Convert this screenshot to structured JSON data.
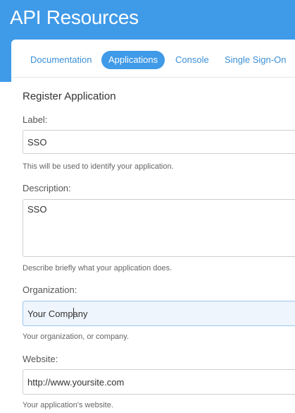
{
  "header": {
    "title": "API Resources"
  },
  "tabs": [
    {
      "label": "Documentation",
      "active": false
    },
    {
      "label": "Applications",
      "active": true
    },
    {
      "label": "Console",
      "active": false
    },
    {
      "label": "Single Sign-On",
      "active": false
    }
  ],
  "form": {
    "title": "Register Application",
    "fields": {
      "label": {
        "label": "Label:",
        "value": "SSO",
        "help": "This will be used to identify your application."
      },
      "description": {
        "label": "Description:",
        "value": "SSO",
        "help": "Describe briefly what your application does."
      },
      "organization": {
        "label": "Organization:",
        "value": "Your Company",
        "help": "Your organization, or company."
      },
      "website": {
        "label": "Website:",
        "value": "http://www.yoursite.com",
        "help": "Your application's website."
      }
    }
  },
  "colors": {
    "brand_blue": "#3f9ae8",
    "tab_text": "#3a8fd6",
    "focused_input_bg": "#eef5fd"
  }
}
